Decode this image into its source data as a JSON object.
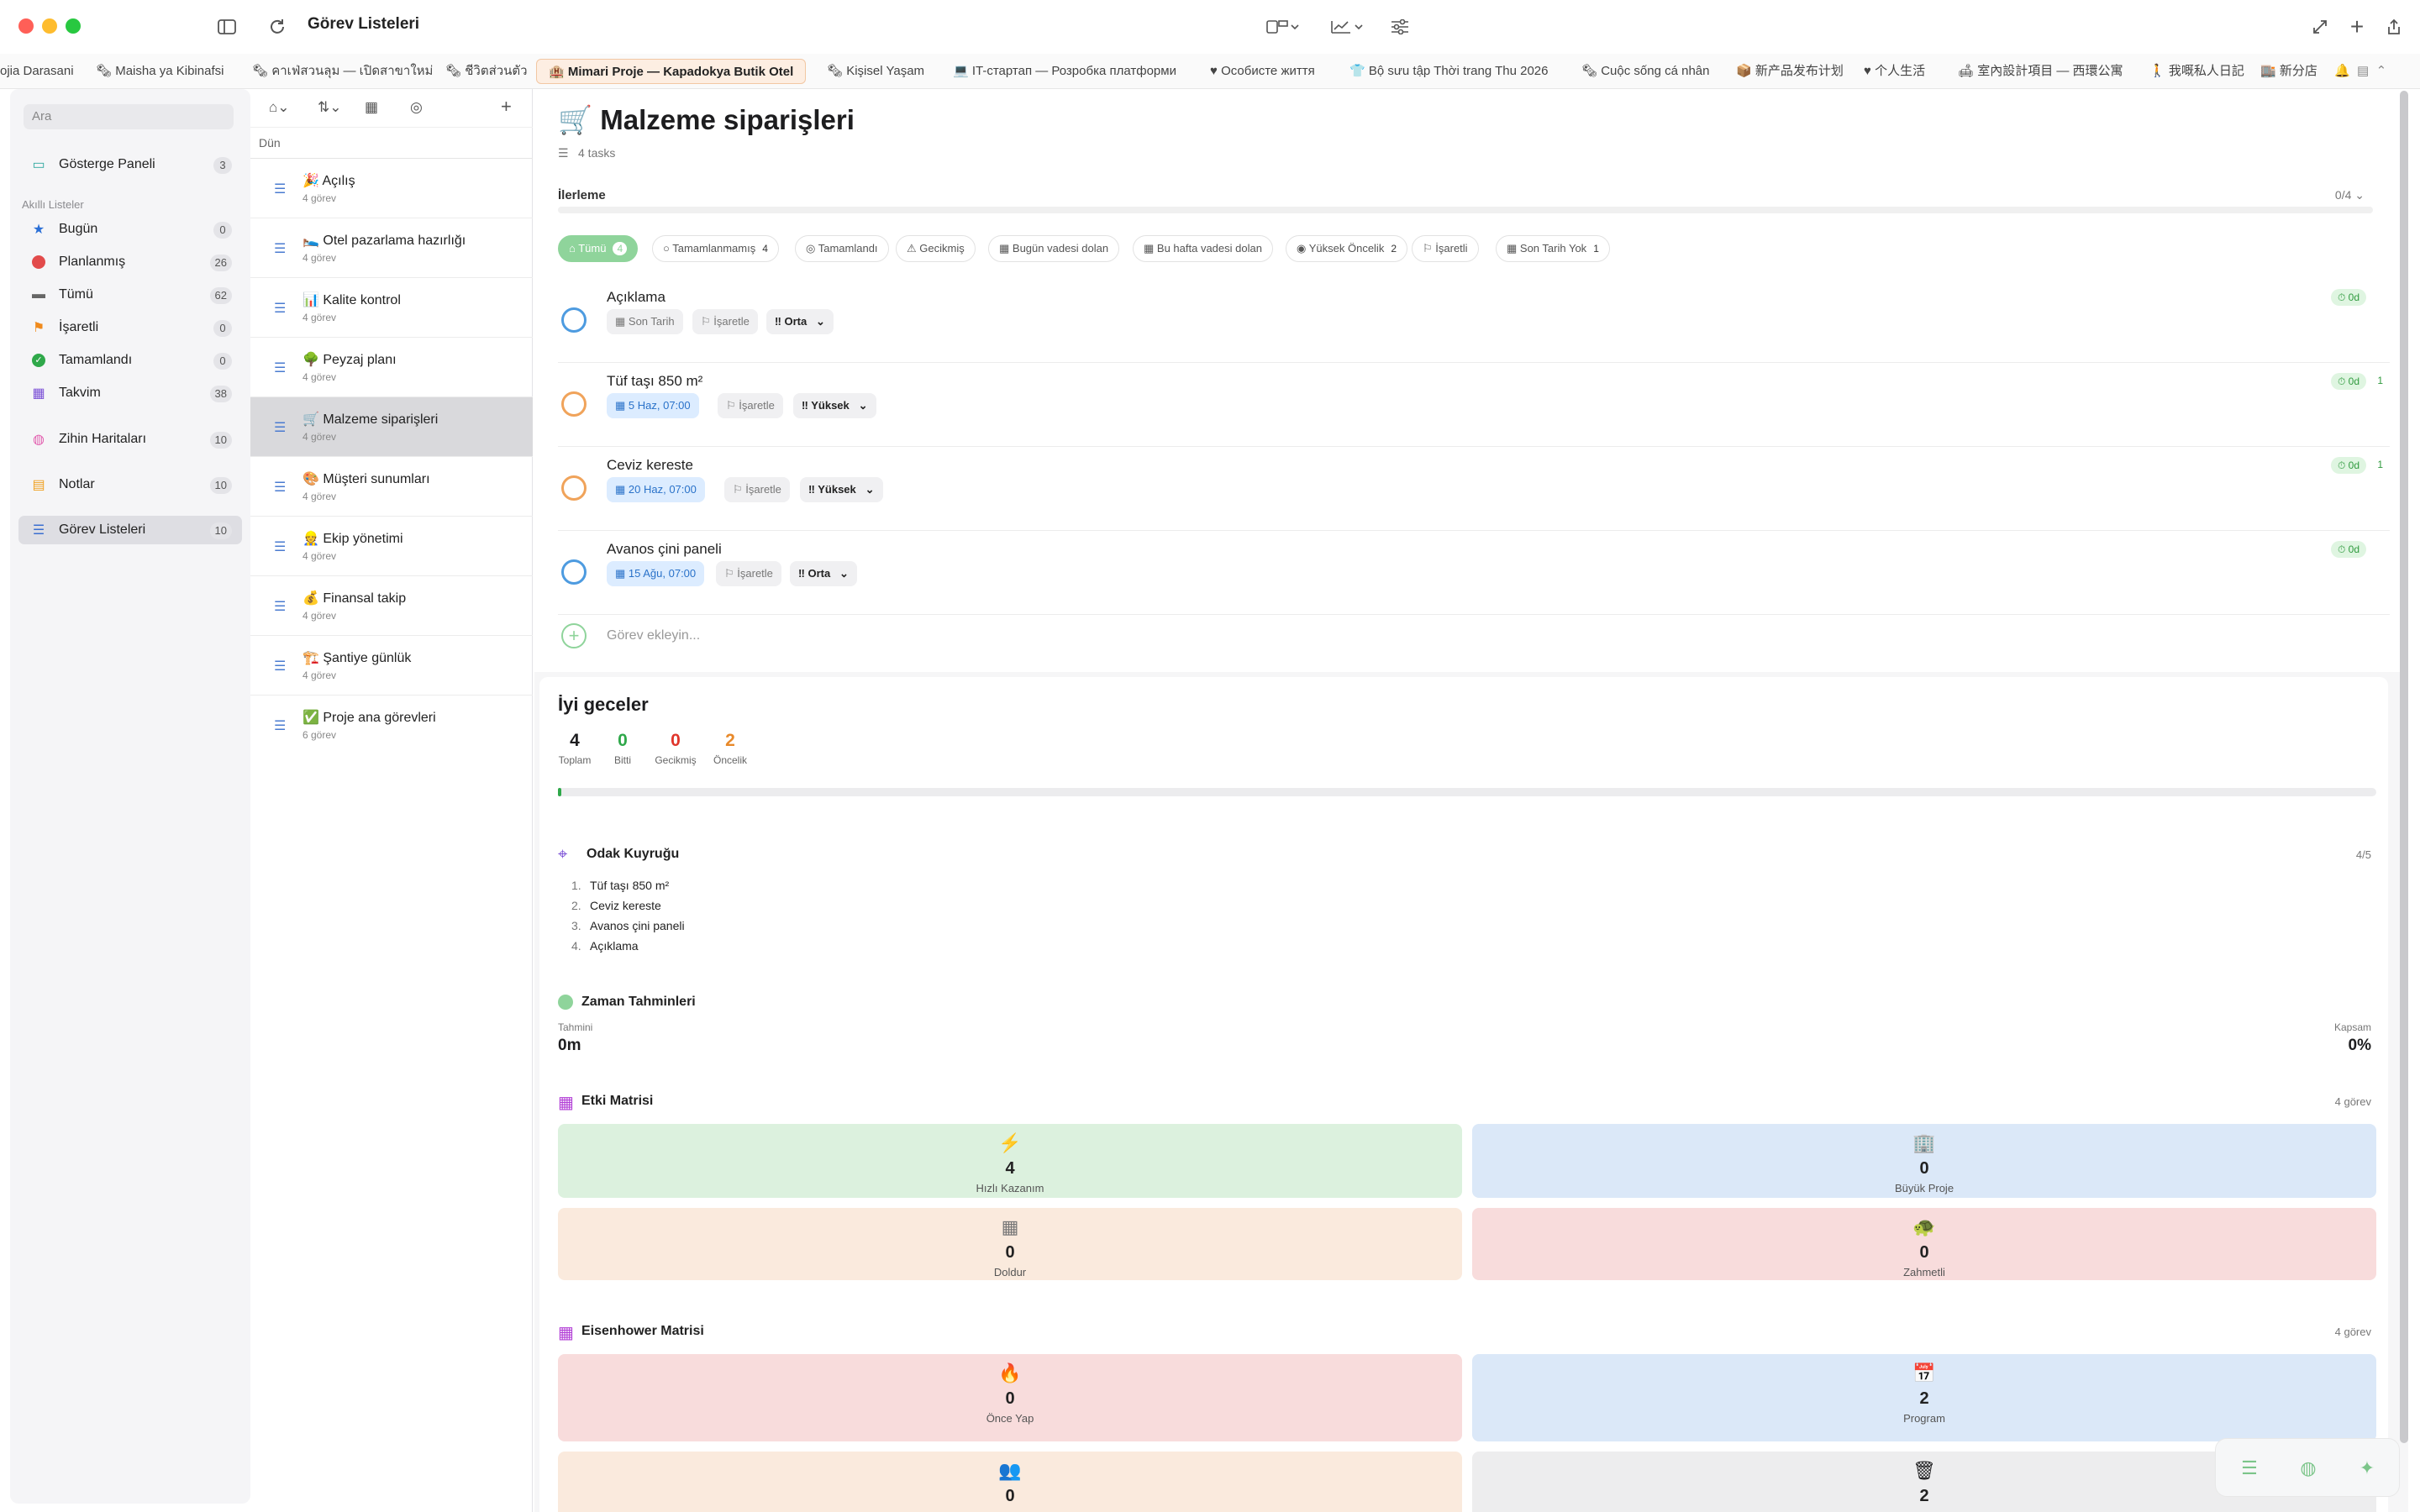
{
  "window": {
    "title": "Görev Listeleri"
  },
  "tabs": [
    "ojia Darasani",
    "Maisha ya Kibinafsi",
    "คาเฟ่สวนลุม — เปิดสาขาใหม่",
    "ชีวิตส่วนตัว",
    "Mimari Proje — Kapadokya Butik Otel",
    "Kişisel Yaşam",
    "IT-стартап — Розробка платформи",
    "Особисте життя",
    "Bộ sưu tập Thời trang Thu 2026",
    "Cuộc sống cá nhân",
    "新产品发布计划",
    "个人生活",
    "室內設計項目 — 西環公寓",
    "我嘅私人日記",
    "新分店"
  ],
  "sidebar": {
    "search_placeholder": "Ara",
    "dashboard": {
      "label": "Gösterge Paneli",
      "count": "3"
    },
    "smart_section": "Akıllı Listeler",
    "items": [
      {
        "label": "Bugün",
        "count": "0"
      },
      {
        "label": "Planlanmış",
        "count": "26"
      },
      {
        "label": "Tümü",
        "count": "62"
      },
      {
        "label": "İşaretli",
        "count": "0"
      },
      {
        "label": "Tamamlandı",
        "count": "0"
      },
      {
        "label": "Takvim",
        "count": "38"
      }
    ],
    "mindmaps": {
      "label": "Zihin Haritaları",
      "count": "10"
    },
    "notes": {
      "label": "Notlar",
      "count": "10"
    },
    "tasklists": {
      "label": "Görev Listeleri",
      "count": "10"
    }
  },
  "list_column": {
    "date_header": "Dün",
    "lists": [
      {
        "emoji": "🎉",
        "title": "Açılış",
        "sub": "4 görev"
      },
      {
        "emoji": "🛌",
        "title": "Otel pazarlama hazırlığı",
        "sub": "4 görev"
      },
      {
        "emoji": "📊",
        "title": "Kalite kontrol",
        "sub": "4 görev"
      },
      {
        "emoji": "🌳",
        "title": "Peyzaj planı",
        "sub": "4 görev"
      },
      {
        "emoji": "🛒",
        "title": "Malzeme siparişleri",
        "sub": "4 görev"
      },
      {
        "emoji": "🎨",
        "title": "Müşteri sunumları",
        "sub": "4 görev"
      },
      {
        "emoji": "👷",
        "title": "Ekip yönetimi",
        "sub": "4 görev"
      },
      {
        "emoji": "💰",
        "title": "Finansal takip",
        "sub": "4 görev"
      },
      {
        "emoji": "🏗️",
        "title": "Şantiye günlük",
        "sub": "4 görev"
      },
      {
        "emoji": "✅",
        "title": "Proje ana görevleri",
        "sub": "6 görev"
      }
    ]
  },
  "main": {
    "emoji": "🛒",
    "title": "Malzeme siparişleri",
    "task_count": "4 tasks",
    "progress_label": "İlerleme",
    "progress_value": "0/4",
    "progress_fraction": 0,
    "filters": [
      {
        "label": "Tümü",
        "count": "4"
      },
      {
        "label": "Tamamlanmamış",
        "count": "4"
      },
      {
        "label": "Tamamlandı",
        "count": ""
      },
      {
        "label": "Gecikmiş",
        "count": ""
      },
      {
        "label": "Bugün vadesi dolan",
        "count": ""
      },
      {
        "label": "Bu hafta vadesi dolan",
        "count": ""
      },
      {
        "label": "Yüksek Öncelik",
        "count": "2"
      },
      {
        "label": "İşaretli",
        "count": ""
      },
      {
        "label": "Son Tarih Yok",
        "count": "1"
      }
    ],
    "tasks": [
      {
        "title": "Açıklama",
        "date": "Son Tarih",
        "flag": "İşaretle",
        "priority": "Orta",
        "time": "0d",
        "extra": ""
      },
      {
        "title": "Tüf taşı 850 m²",
        "date": "5 Haz, 07:00",
        "flag": "İşaretle",
        "priority": "Yüksek",
        "time": "0d",
        "extra": "1"
      },
      {
        "title": "Ceviz kereste",
        "date": "20 Haz, 07:00",
        "flag": "İşaretle",
        "priority": "Yüksek",
        "time": "0d",
        "extra": "1"
      },
      {
        "title": "Avanos çini paneli",
        "date": "15 Ağu, 07:00",
        "flag": "İşaretle",
        "priority": "Orta",
        "time": "0d",
        "extra": ""
      }
    ],
    "add_task_placeholder": "Görev ekleyin..."
  },
  "goodnight": {
    "title": "İyi geceler",
    "stats": [
      {
        "n": "4",
        "l": "Toplam",
        "color": "#1d1d1f"
      },
      {
        "n": "0",
        "l": "Bitti",
        "color": "#2fa84a"
      },
      {
        "n": "0",
        "l": "Gecikmiş",
        "color": "#e0352b"
      },
      {
        "n": "2",
        "l": "Öncelik",
        "color": "#e8892a"
      }
    ]
  },
  "focus_queue": {
    "title": "Odak Kuyruğu",
    "count": "4/5",
    "items": [
      "Tüf taşı 850 m²",
      "Ceviz kereste",
      "Avanos çini paneli",
      "Açıklama"
    ]
  },
  "time_estimates": {
    "title": "Zaman Tahminleri",
    "estimate_label": "Tahmini",
    "estimate_value": "0m",
    "coverage_label": "Kapsam",
    "coverage_value": "0%"
  },
  "impact_matrix": {
    "title": "Etki Matrisi",
    "count": "4 görev",
    "cells": [
      {
        "n": "4",
        "l": "Hızlı Kazanım",
        "icon": "bolt-icon"
      },
      {
        "n": "0",
        "l": "Büyük Proje",
        "icon": "building-icon"
      },
      {
        "n": "0",
        "l": "Doldur",
        "icon": "grid-icon"
      },
      {
        "n": "0",
        "l": "Zahmetli",
        "icon": "turtle-icon"
      }
    ]
  },
  "eisenhower": {
    "title": "Eisenhower Matrisi",
    "count": "4 görev",
    "cells": [
      {
        "n": "0",
        "l": "Önce Yap",
        "icon": "fire-icon"
      },
      {
        "n": "2",
        "l": "Program",
        "icon": "calendar-icon"
      },
      {
        "n": "0",
        "l": "",
        "icon": "people-icon"
      },
      {
        "n": "2",
        "l": "",
        "icon": "trash-icon"
      }
    ]
  },
  "colors": {
    "accent_green": "#8fd49b",
    "tab_active_bg": "#fdeee2",
    "blue_date": "#2a72c9"
  }
}
